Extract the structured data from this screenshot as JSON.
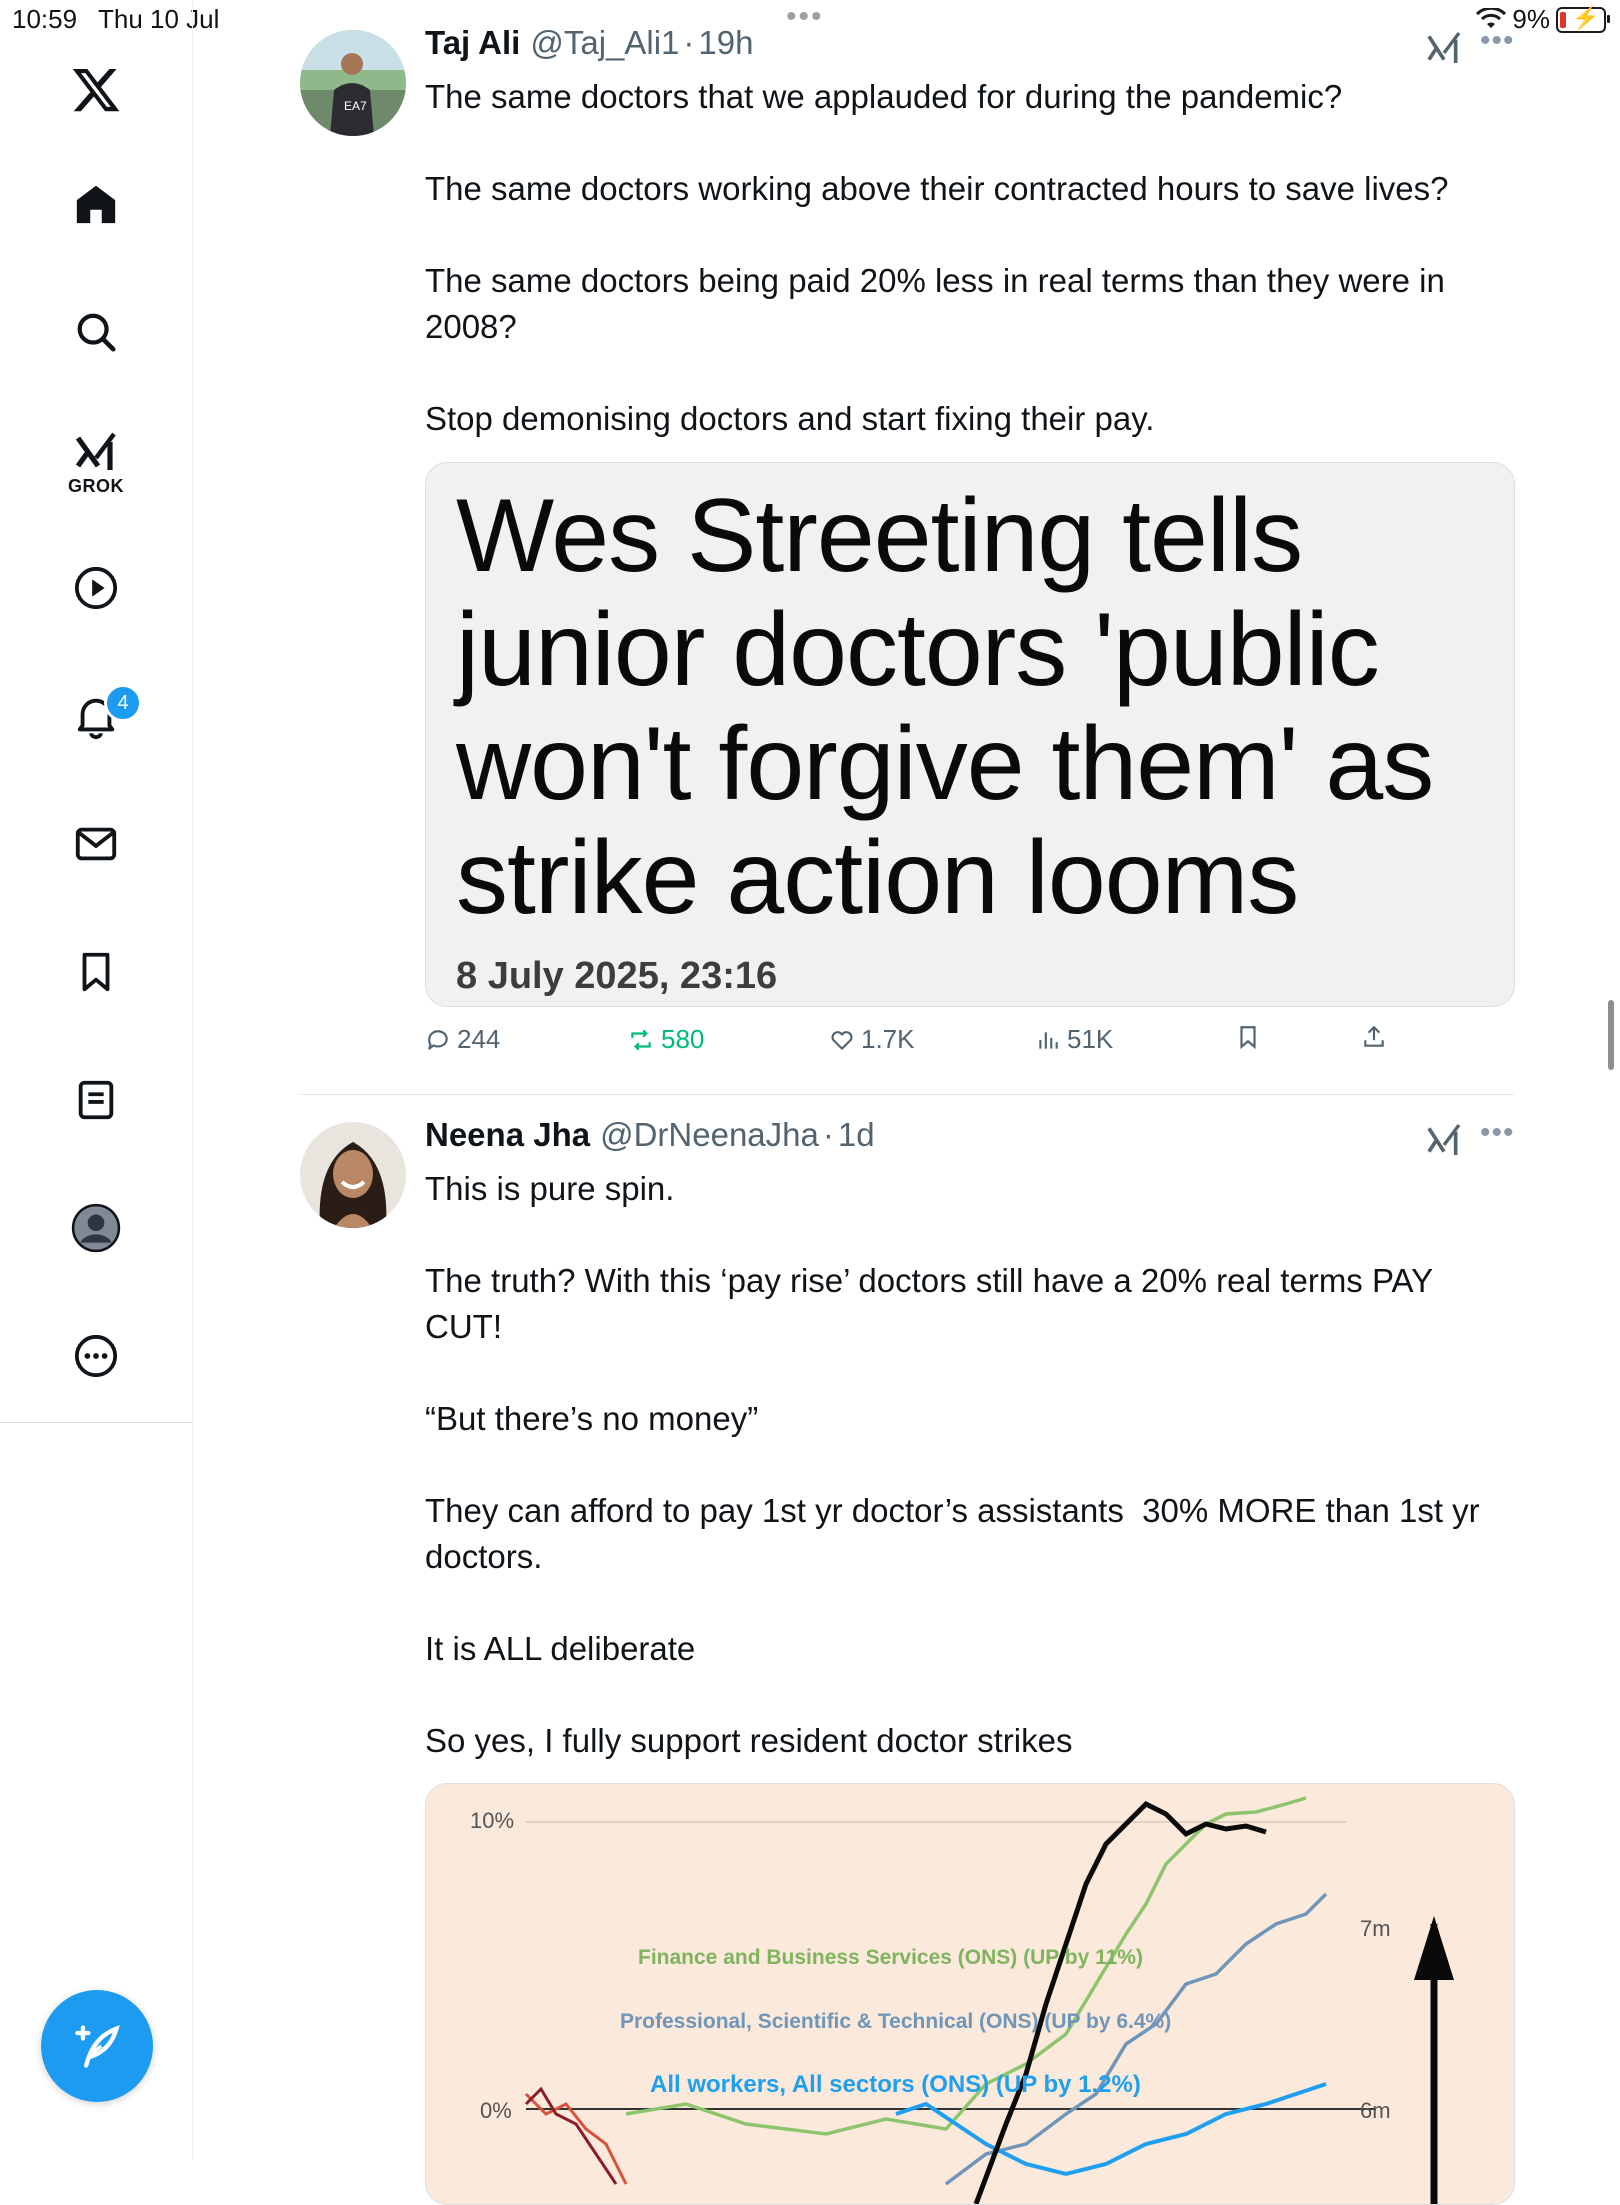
{
  "status_bar": {
    "time": "10:59",
    "date": "Thu 10 Jul",
    "battery": "9%"
  },
  "sidebar": {
    "items": [
      {
        "name": "X logo",
        "icon": "x-logo-icon"
      },
      {
        "name": "Home",
        "icon": "home-icon"
      },
      {
        "name": "Search",
        "icon": "search-icon"
      },
      {
        "name": "Grok",
        "icon": "grok-icon",
        "label": "GROK"
      },
      {
        "name": "Videos",
        "icon": "play-icon"
      },
      {
        "name": "Notifications",
        "icon": "bell-icon",
        "badge": "4"
      },
      {
        "name": "Messages",
        "icon": "mail-icon"
      },
      {
        "name": "Bookmarks",
        "icon": "bookmark-icon"
      },
      {
        "name": "Lists",
        "icon": "list-icon"
      },
      {
        "name": "Profile",
        "icon": "avatar-icon"
      },
      {
        "name": "More",
        "icon": "more-circle-icon"
      }
    ],
    "compose_icon": "compose-feather-icon"
  },
  "tweets": [
    {
      "name": "Taj Ali",
      "handle": "@Taj_Ali1",
      "sep": "·",
      "time": "19h",
      "paragraphs": [
        "The same doctors that we applauded for during the pandemic?",
        "The same doctors working above their contracted hours to save lives?",
        "The same doctors being paid 20% less in real terms than they were in 2008?",
        "Stop demonising doctors and start fixing their pay."
      ],
      "media": {
        "headline": "Wes Streeting tells junior doctors 'public won't forgive them' as strike action looms",
        "date": "8 July 2025, 23:16"
      },
      "actions": {
        "replies": "244",
        "reposts": "580",
        "likes": "1.7K",
        "views": "51K"
      }
    },
    {
      "name": "Neena Jha",
      "handle": "@DrNeenaJha",
      "sep": "·",
      "time": "1d",
      "paragraphs": [
        "This is pure spin.",
        "The truth? With this ‘pay rise’ doctors still have a 20% real terms PAY CUT!",
        "“But there’s no money”",
        "They can afford to pay 1st yr doctor’s assistants  30% MORE than 1st yr doctors.",
        "It is ALL deliberate",
        "So yes, I fully support resident doctor strikes"
      ],
      "chart": {
        "y_left_ticks": [
          "10%",
          "0%"
        ],
        "y_right_ticks": [
          "7m",
          "6m"
        ],
        "labels": [
          "Finance and Business Services (ONS) (UP by 11%)",
          "Professional, Scientific & Technical (ONS) (UP by 6.4%)",
          "All workers, All sectors (ONS) (UP by 1.2%)"
        ],
        "colors": {
          "finance": "#8cc56b",
          "professional": "#6f95b8",
          "all_workers": "#1f9ff0",
          "black": "#0a0a0a",
          "red": "#d9523a",
          "maroon": "#8a1c2b"
        }
      }
    }
  ]
}
